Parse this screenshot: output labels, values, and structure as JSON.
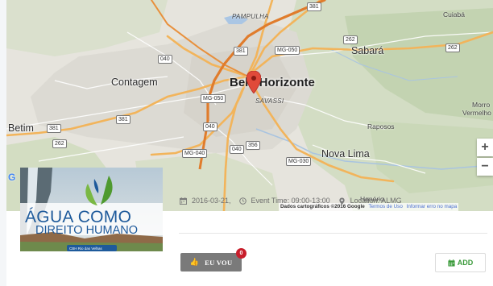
{
  "map": {
    "cities": {
      "pampulha": "PAMPULHA",
      "contagem": "Contagem",
      "belo_horizonte": "Belo Horizonte",
      "savassi": "SAVASSI",
      "sabara": "Sabará",
      "cuiaba": "Cuiabá",
      "betim": "Betim",
      "raposos": "Raposos",
      "nova_lima": "Nova Lima",
      "honorio": "Honório",
      "morro_vermelho_1": "Morro",
      "morro_vermelho_2": "Vermelho"
    },
    "shields": {
      "s381a": "381",
      "s381b": "381",
      "s262a": "262",
      "s262b": "262",
      "s040a": "040",
      "smg050a": "MG-050",
      "smg050b": "MG-050",
      "s381c": "381",
      "s381d": "381",
      "s262c": "262",
      "s040b": "040",
      "s040c": "040",
      "smg040": "MG-040",
      "s356": "356",
      "smg030": "MG-030"
    },
    "zoom_in": "+",
    "zoom_out": "−",
    "attribution_data": "Dados cartográficos ©2016 Google",
    "attribution_terms": "Termos de Uso",
    "attribution_report": "Informar erro no mapa",
    "google_letter": "G"
  },
  "logo": {
    "line1": "ÁGUA COMO",
    "line2": "DIREITO HUMANO",
    "footer": "CBH Rio das Velhas"
  },
  "event": {
    "date": "2016-03-21,",
    "time": "Event Time: 09:00-13:00",
    "location": "Location: ALMG"
  },
  "actions": {
    "eu_vou": "EU VOU",
    "eu_vou_count": "0",
    "add": "ADD"
  },
  "colors": {
    "accent_green": "#3a9a3a",
    "badge_red": "#c81e2b",
    "pin_red": "#e04a3a",
    "button_gray": "#7a7a7a"
  }
}
